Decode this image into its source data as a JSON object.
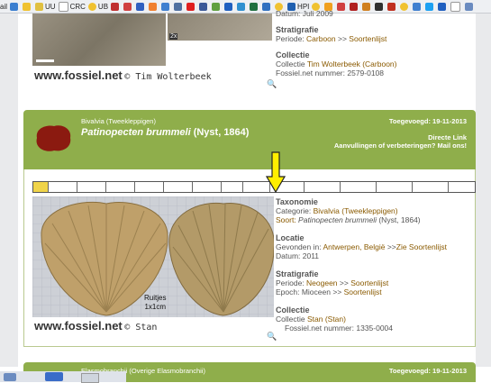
{
  "bookmarks": {
    "items": [
      "ail",
      "",
      "UU",
      "CRC",
      "UB",
      "HPI"
    ]
  },
  "top_entry": {
    "image_badge": "2x",
    "datum_fragment": "Datum: Juli 2009",
    "watermark_site": "www.fossiel.net",
    "watermark_owner": "© Tim Wolterbeek",
    "stratigrafie_title": "Stratigrafie",
    "periode_label": "Periode: ",
    "periode_value": "Carboon",
    "periode_sep": " >> ",
    "periode_list": "Soortenlijst",
    "collectie_title": "Collectie",
    "collectie_label": "Collectie ",
    "collectie_value": "Tim Wolterbeek (Carboon)",
    "nummer": "Fossiel.net nummer: 2579-0108"
  },
  "entry": {
    "category": "Bivalvia (Tweekleppigen)",
    "name_italic": "Patinopecten brummeli",
    "name_author": " (Nyst, 1864)",
    "added": "Toegevoegd: 19-11-2013",
    "direct_link": "Directe Link",
    "improvements": "Aanvullingen of verbeteringen? Mail ons!",
    "photo_label_line1": "Ruitjes",
    "photo_label_line2": "1x1cm",
    "watermark_site": "www.fossiel.net",
    "watermark_owner": "© Stan",
    "taxonomie": {
      "title": "Taxonomie",
      "categorie_label": "Categorie: ",
      "categorie_value": "Bivalvia (Tweekleppigen)",
      "soort_label": "Soort: ",
      "soort_value": "Patinopecten brummeli",
      "soort_author": " (Nyst, 1864)"
    },
    "locatie": {
      "title": "Locatie",
      "gevonden_label": "Gevonden in: ",
      "gevonden_value": "Antwerpen, België",
      "gevonden_sep": " >>",
      "gevonden_list": "Zie Soortenlijst",
      "datum": "Datum: 2011"
    },
    "stratigrafie": {
      "title": "Stratigrafie",
      "periode_label": "Periode: ",
      "periode_value": "Neogeen",
      "periode_sep": " >> ",
      "periode_list": "Soortenlijst",
      "epoch_label": "Epoch: Mioceen >> ",
      "epoch_list": "Soortenlijst"
    },
    "collectie": {
      "title": "Collectie",
      "label": "Collectie ",
      "value": "Stan (Stan)",
      "nummer": "Fossiel.net nummer: 1335-0004"
    }
  },
  "next_entry": {
    "category": "Elasmobranchii (Overige Elasmobranchii)",
    "added": "Toegevoegd: 19-11-2013"
  },
  "colors": {
    "header_green": "#8fae4b",
    "link_brown": "#8a5a00",
    "arrow_yellow": "#ffee00",
    "timeline_marker": "#f0d44a"
  }
}
